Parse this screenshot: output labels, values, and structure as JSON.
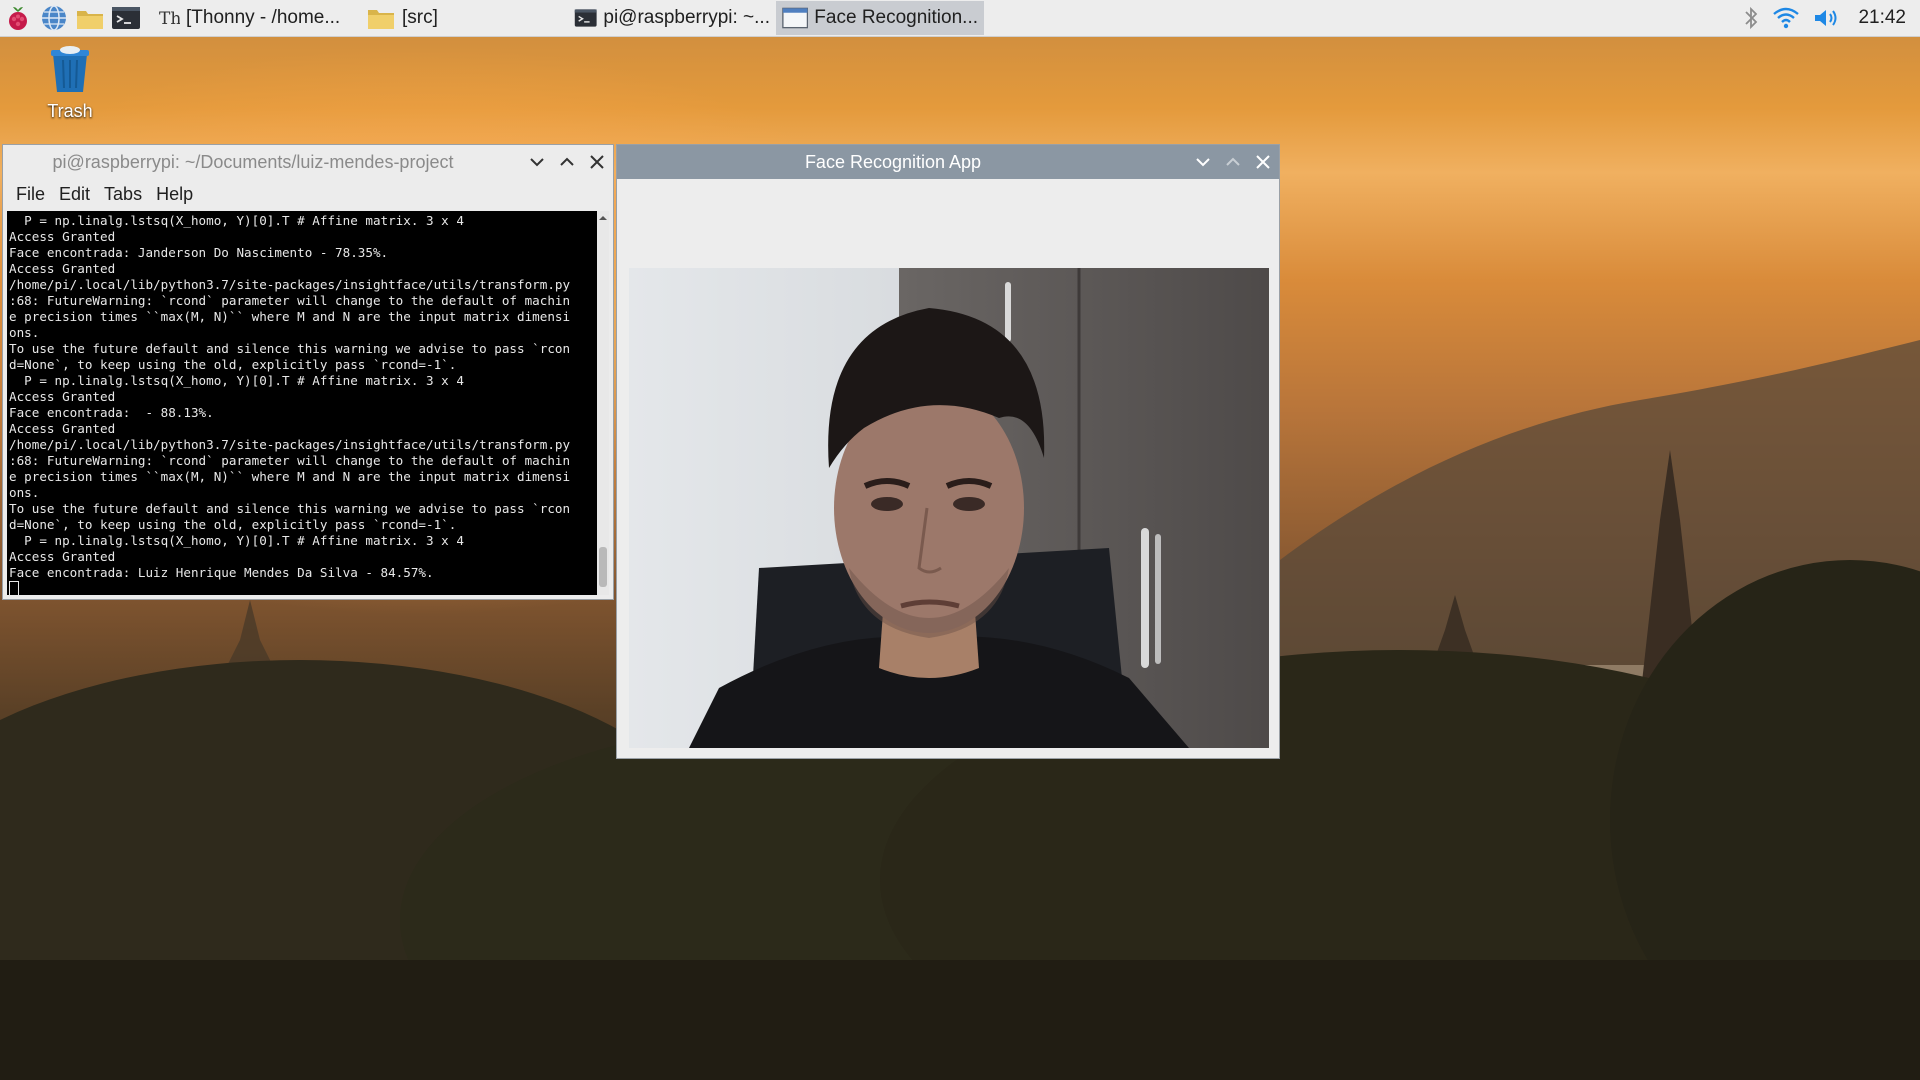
{
  "taskbar": {
    "launchers": [
      "raspberry-menu-icon",
      "web-browser-icon",
      "file-manager-icon",
      "terminal-icon"
    ],
    "tasks": [
      {
        "label": "[Thonny  -  /home...",
        "icon": "thonny-icon"
      },
      {
        "label": "[src]",
        "icon": "folder-icon"
      },
      {
        "label": "pi@raspberrypi: ~...",
        "icon": "terminal-icon"
      },
      {
        "label": "Face Recognition...",
        "icon": "window-icon"
      }
    ],
    "tray": {
      "icons": [
        "bluetooth-icon",
        "wifi-icon",
        "volume-icon"
      ],
      "clock": "21:42"
    }
  },
  "desktop": {
    "trash_label": "Trash"
  },
  "terminal": {
    "title": "pi@raspberrypi: ~/Documents/luiz-mendes-project",
    "menu": [
      "File",
      "Edit",
      "Tabs",
      "Help"
    ],
    "lines": [
      "  P = np.linalg.lstsq(X_homo, Y)[0].T # Affine matrix. 3 x 4",
      "Access Granted",
      "Face encontrada: Janderson Do Nascimento - 78.35%.",
      "Access Granted",
      "/home/pi/.local/lib/python3.7/site-packages/insightface/utils/transform.py",
      ":68: FutureWarning: `rcond` parameter will change to the default of machin",
      "e precision times ``max(M, N)`` where M and N are the input matrix dimensi",
      "ons.",
      "To use the future default and silence this warning we advise to pass `rcon",
      "d=None`, to keep using the old, explicitly pass `rcond=-1`.",
      "  P = np.linalg.lstsq(X_homo, Y)[0].T # Affine matrix. 3 x 4",
      "Access Granted",
      "Face encontrada:  - 88.13%.",
      "Access Granted",
      "/home/pi/.local/lib/python3.7/site-packages/insightface/utils/transform.py",
      ":68: FutureWarning: `rcond` parameter will change to the default of machin",
      "e precision times ``max(M, N)`` where M and N are the input matrix dimensi",
      "ons.",
      "To use the future default and silence this warning we advise to pass `rcon",
      "d=None`, to keep using the old, explicitly pass `rcond=-1`.",
      "  P = np.linalg.lstsq(X_homo, Y)[0].T # Affine matrix. 3 x 4",
      "Access Granted",
      "Face encontrada: Luiz Henrique Mendes Da Silva - 84.57%."
    ]
  },
  "face_app": {
    "title": "Face Recognition App"
  },
  "colors": {
    "accent": "#c9ccd1",
    "face_titlebar": "#8b97a3"
  }
}
